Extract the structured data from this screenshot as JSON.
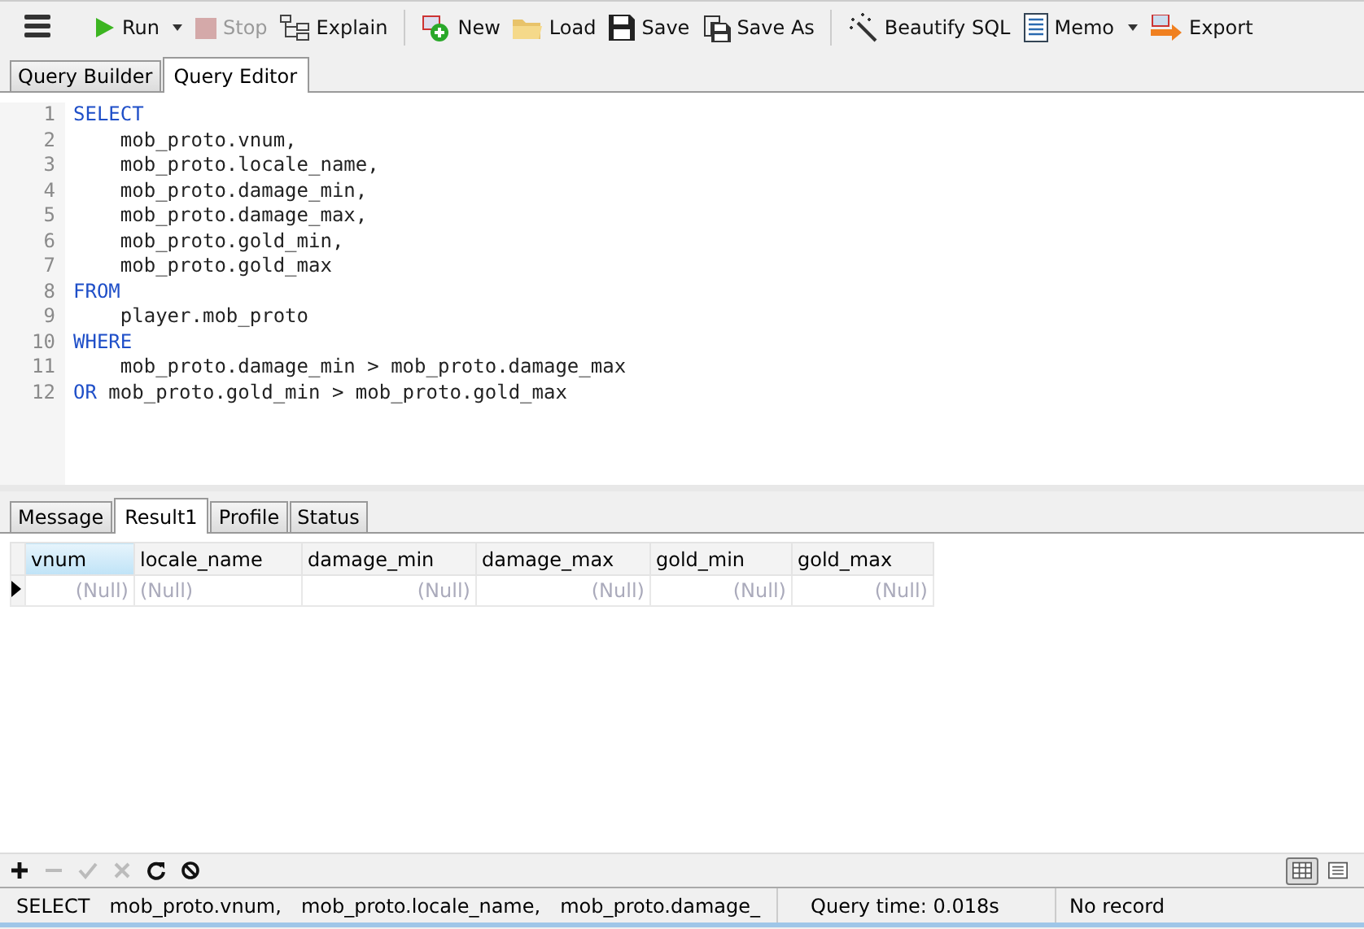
{
  "toolbar": [
    {
      "kind": "menu"
    },
    {
      "kind": "button",
      "label": "Run",
      "dropdown": true,
      "disabled": false
    },
    {
      "kind": "button",
      "label": "Stop",
      "dropdown": false,
      "disabled": true
    },
    {
      "kind": "button",
      "label": "Explain",
      "dropdown": false,
      "disabled": false
    },
    {
      "kind": "separator"
    },
    {
      "kind": "button",
      "label": "New",
      "dropdown": false,
      "disabled": false
    },
    {
      "kind": "button",
      "label": "Load",
      "dropdown": false,
      "disabled": false
    },
    {
      "kind": "button",
      "label": "Save",
      "dropdown": false,
      "disabled": false
    },
    {
      "kind": "button",
      "label": "Save As",
      "dropdown": false,
      "disabled": false
    },
    {
      "kind": "separator"
    },
    {
      "kind": "button",
      "label": "Beautify SQL",
      "dropdown": false,
      "disabled": false
    },
    {
      "kind": "button",
      "label": "Memo",
      "dropdown": true,
      "disabled": false
    },
    {
      "kind": "button",
      "label": "Export",
      "dropdown": false,
      "disabled": false
    }
  ],
  "tabs": [
    {
      "label": "Query Builder",
      "selected": false
    },
    {
      "label": "Query Editor",
      "selected": true
    }
  ],
  "editor": {
    "lines": [
      {
        "number": "1",
        "parts": [
          {
            "kind": "keyword",
            "text": "SELECT"
          }
        ]
      },
      {
        "number": "2",
        "parts": [
          {
            "kind": "plain",
            "text": "    mob_proto.vnum,"
          }
        ]
      },
      {
        "number": "3",
        "parts": [
          {
            "kind": "plain",
            "text": "    mob_proto.locale_name,"
          }
        ]
      },
      {
        "number": "4",
        "parts": [
          {
            "kind": "plain",
            "text": "    mob_proto.damage_min,"
          }
        ]
      },
      {
        "number": "5",
        "parts": [
          {
            "kind": "plain",
            "text": "    mob_proto.damage_max,"
          }
        ]
      },
      {
        "number": "6",
        "parts": [
          {
            "kind": "plain",
            "text": "    mob_proto.gold_min,"
          }
        ]
      },
      {
        "number": "7",
        "parts": [
          {
            "kind": "plain",
            "text": "    mob_proto.gold_max"
          }
        ]
      },
      {
        "number": "8",
        "parts": [
          {
            "kind": "keyword",
            "text": "FROM"
          }
        ]
      },
      {
        "number": "9",
        "parts": [
          {
            "kind": "plain",
            "text": "    player.mob_proto"
          }
        ]
      },
      {
        "number": "10",
        "parts": [
          {
            "kind": "keyword",
            "text": "WHERE"
          }
        ]
      },
      {
        "number": "11",
        "parts": [
          {
            "kind": "plain",
            "text": "    mob_proto.damage_min > mob_proto.damage_max"
          }
        ]
      },
      {
        "number": "12",
        "parts": [
          {
            "kind": "keyword",
            "text": "OR"
          },
          {
            "kind": "plain",
            "text": " mob_proto.gold_min > mob_proto.gold_max"
          }
        ]
      }
    ]
  },
  "result_tabs": [
    {
      "label": "Message",
      "selected": false
    },
    {
      "label": "Result1",
      "selected": true
    },
    {
      "label": "Profile",
      "selected": false
    },
    {
      "label": "Status",
      "selected": false
    }
  ],
  "table": {
    "columns": [
      {
        "name": "vnum",
        "kind": "number",
        "selected": true
      },
      {
        "name": "locale_name",
        "kind": "text",
        "selected": false
      },
      {
        "name": "damage_min",
        "kind": "number",
        "selected": false
      },
      {
        "name": "damage_max",
        "kind": "number",
        "selected": false
      },
      {
        "name": "gold_min",
        "kind": "number",
        "selected": false
      },
      {
        "name": "gold_max",
        "kind": "number",
        "selected": false
      }
    ],
    "rows": [
      {
        "current": true,
        "cells": [
          "(Null)",
          "(Null)",
          "(Null)",
          "(Null)",
          "(Null)",
          "(Null)"
        ]
      }
    ]
  },
  "grid_toolbar": [
    {
      "disabled": false
    },
    {
      "disabled": true
    },
    {
      "disabled": true
    },
    {
      "disabled": true
    },
    {
      "disabled": false
    },
    {
      "disabled": false
    }
  ],
  "view_modes": [
    {
      "selected": true
    },
    {
      "selected": false
    }
  ],
  "status_bar": {
    "sql": [
      "SELECT",
      "mob_proto.vnum,",
      "mob_proto.locale_name,",
      "mob_proto.damage_"
    ],
    "query_time": "Query time: 0.018s",
    "records": "No record"
  }
}
